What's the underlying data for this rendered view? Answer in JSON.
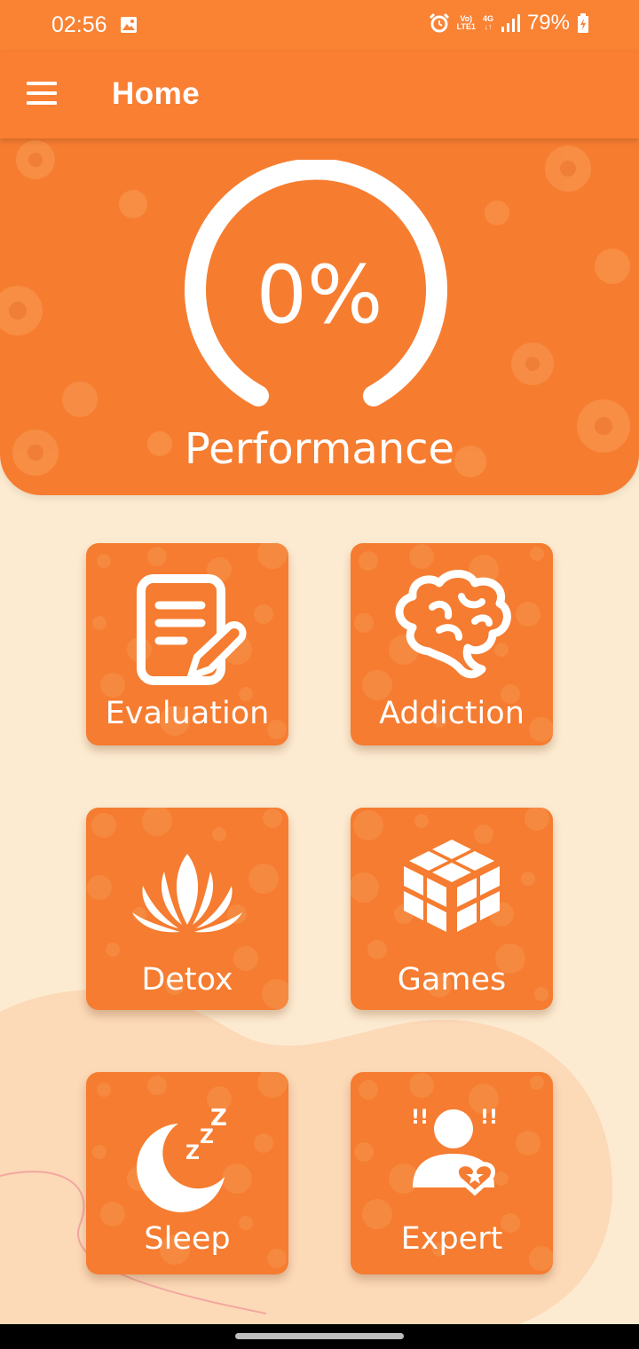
{
  "status_bar": {
    "time": "02:56",
    "battery": "79%",
    "volte_label": "Vo)",
    "lte_label": "LTE1",
    "network_label": "4G"
  },
  "app_bar": {
    "title": "Home"
  },
  "performance": {
    "value_text": "0%",
    "label": "Performance",
    "progress": 0
  },
  "tiles": [
    {
      "label": "Evaluation",
      "icon": "evaluation-notepad-icon"
    },
    {
      "label": "Addiction",
      "icon": "brain-icon"
    },
    {
      "label": "Detox",
      "icon": "lotus-icon"
    },
    {
      "label": "Games",
      "icon": "cube-icon"
    },
    {
      "label": "Sleep",
      "icon": "moon-sleep-icon"
    },
    {
      "label": "Expert",
      "icon": "expert-person-icon"
    }
  ],
  "colors": {
    "primary": "#f98233",
    "background": "#fdebd1",
    "tile": "#f57c30"
  }
}
